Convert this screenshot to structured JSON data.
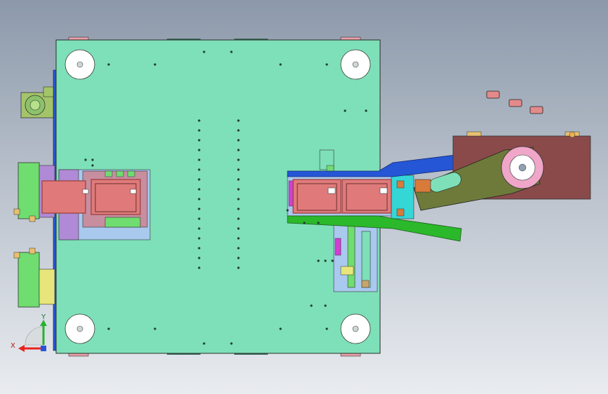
{
  "viewport": {
    "kind": "cad-3d-viewport",
    "view": "top"
  },
  "triad": {
    "x_label": "X",
    "y_label": "Y",
    "x_color": "#e8231e",
    "y_color": "#25b233",
    "z_color": "#2a55d8"
  },
  "colors": {
    "base_plate": "#7ee0b8",
    "outline": "#2a2a2a",
    "hole_fill": "#ffffff",
    "insert": "#e07a7a",
    "insert_frame": "#a04848",
    "arm": "#6e7a3a",
    "guide_blue": "#2456d6",
    "guide_green": "#2bb82b",
    "motor_housing": "#8a4a4a",
    "cyan_block": "#35d6d6",
    "magenta": "#d23fd2",
    "yellow": "#e6e67a",
    "side_block": "#6fdd6f",
    "violet": "#b08ad6",
    "bracket": "#c7e39a"
  },
  "icons": [
    "coordinate-triad-icon"
  ]
}
